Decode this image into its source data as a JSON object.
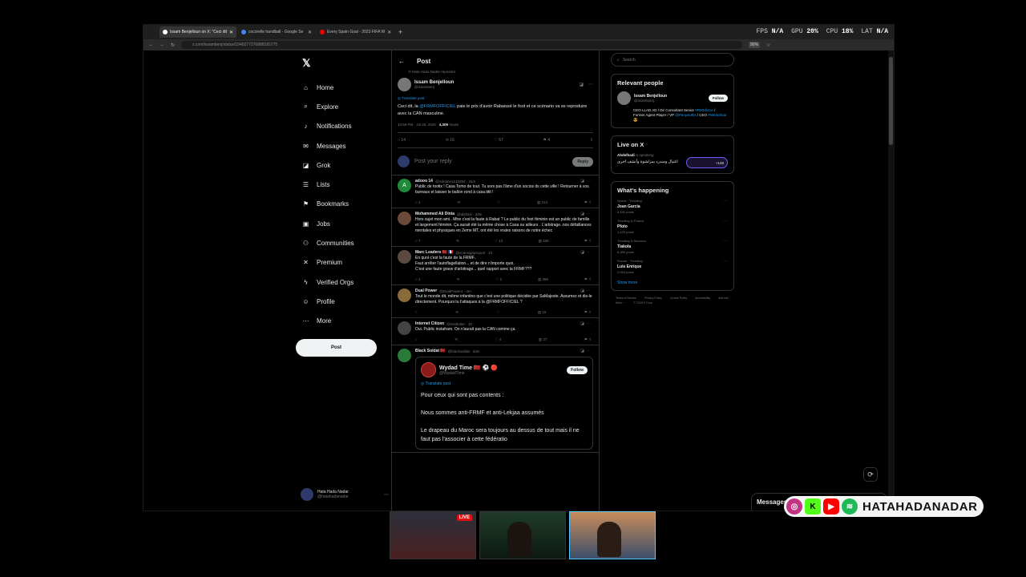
{
  "browser": {
    "tabs": [
      {
        "label": "Issam Benjelloun on X: \"Ceci dit",
        "active": true,
        "color": "#ffffff"
      },
      {
        "label": "cocorelle handball - Google Se",
        "active": false,
        "color": "#4285f4"
      },
      {
        "label": "Every Spain Goal - 2023 FIFA W",
        "active": false,
        "color": "#ff0000"
      }
    ],
    "url": "x.com/issambenj/status/1949277276888182775",
    "zoom": "90%"
  },
  "stats": {
    "fps_label": "FPS",
    "fps_value": "N/A",
    "gpu_label": "GPU",
    "gpu_value": "20%",
    "cpu_label": "CPU",
    "cpu_value": "18%",
    "lat_label": "LAT",
    "lat_value": "N/A"
  },
  "nav": {
    "items": [
      {
        "label": "Home",
        "icon": "home-icon",
        "glyph": "⌂"
      },
      {
        "label": "Explore",
        "icon": "search-icon",
        "glyph": "⌕"
      },
      {
        "label": "Notifications",
        "icon": "bell-icon",
        "glyph": "♪"
      },
      {
        "label": "Messages",
        "icon": "mail-icon",
        "glyph": "✉"
      },
      {
        "label": "Grok",
        "icon": "grok-icon",
        "glyph": "◪"
      },
      {
        "label": "Lists",
        "icon": "list-icon",
        "glyph": "☰"
      },
      {
        "label": "Bookmarks",
        "icon": "bookmark-icon",
        "glyph": "⚑"
      },
      {
        "label": "Jobs",
        "icon": "briefcase-icon",
        "glyph": "▣"
      },
      {
        "label": "Communities",
        "icon": "people-icon",
        "glyph": "⚇"
      },
      {
        "label": "Premium",
        "icon": "x-premium-icon",
        "glyph": "✕"
      },
      {
        "label": "Verified Orgs",
        "icon": "lightning-icon",
        "glyph": "ϟ"
      },
      {
        "label": "Profile",
        "icon": "person-icon",
        "glyph": "☺"
      },
      {
        "label": "More",
        "icon": "more-circle-icon",
        "glyph": "⋯"
      }
    ],
    "post_label": "Post"
  },
  "account": {
    "name": "Hata Hada Nadar",
    "handle": "@hatahadanadar"
  },
  "main": {
    "title": "Post",
    "repost_note": "Hata Hada Nadar reposted",
    "op": {
      "name": "Issam Benjelloun",
      "handle": "@issambenj",
      "translate": "Translate post",
      "text_a": "Ceci dit, la ",
      "mention": "@FRMFOFFICIEL",
      "text_b": " paie le prix d'avoir Rabaissé le foot et ce scénario va se reproduire avec la CAN masculine.",
      "time": "10:59 PM · Jul 26, 2025 · ",
      "views_count": "4,309",
      "views_label": " Views",
      "replies": "14",
      "reposts": "16",
      "likes": "67",
      "bookmarks": "4"
    },
    "reply_placeholder": "Post your reply",
    "reply_button": "Reply",
    "replies": [
      {
        "name": "adooo 14",
        "handle": "@Adnane1213283 · 34m",
        "text": "Public de tootix ! Casa Tomo de tout. Tu sors pas l'âme d'un socios ds cette ville ! Retourner à vos bureaux et laisser le ballon rond à casa.titit !",
        "replies": "1",
        "reposts": "",
        "likes": "",
        "views": "213",
        "avatar": "#1f8a3a",
        "initial": "A"
      },
      {
        "name": "Mohammed Ali Dinia",
        "handle": "@alidinia · 43m",
        "text": "Hors sujet mon ami.. Mtre c'est la faute à Rabat ? Le public du foot féminin est un public de famille et largement féminin. Ça aurait été la même chose à Casa ou ailleurs . L'arbitrage..nos défaillances mentales et physiques en 2eme MT, ont été les vraies raisons de notre échec",
        "replies": "7",
        "reposts": "",
        "likes": "13",
        "views": "335",
        "avatar": "#6b4a3a",
        "initial": ""
      },
      {
        "name": "Marc Leaders 🇲🇦 🇫🇷",
        "handle": "@ecdesignpropod · 1h",
        "text": "En quoi c'est la faute de la FRMF..\nFaut arrêter l'autoflagellation... et de dire n'importe quoi.\nC'est une faute grave d'arbitrage... quel rapport avec la FRMF???",
        "replies": "1",
        "reposts": "",
        "likes": "2",
        "views": "366",
        "avatar": "#5a4a3f",
        "initial": ""
      },
      {
        "name": "Dual Power",
        "handle": "@DualPower4 · 4m",
        "text": "Tout le monde dit, même infantino que c'est une politique décidée par SaMajeste. Assumez et dis-le directement. Pourquoi tu t'attaques à la @FRMFOFFICIEL ?",
        "replies": "",
        "reposts": "",
        "likes": "",
        "views": "15",
        "avatar": "#8a6a3a",
        "initial": ""
      },
      {
        "name": "Internet Citizen",
        "handle": "@nssbmler · 1h",
        "text": "Oui. Public instafram. On n'aurait pas la CAN comme ça.",
        "replies": "",
        "reposts": "",
        "likes": "4",
        "views": "27",
        "avatar": "#444444",
        "initial": ""
      }
    ],
    "quote_reply": {
      "name": "Black Soldat 🇲🇦",
      "handle": "@blacksoldat · 33m",
      "quote_name": "Wydad Time 🇲🇦 ⚽ 🔴",
      "quote_handle": "@WydadTime",
      "follow": "Follow",
      "translate": "Translate post",
      "text": "Pour ceux qui sont pas contents :\n\nNous sommes anti-FRMF et anti-Lekjaa assumés\n\nLe drapeau du Maroc sera toujours au dessus de tout mais il ne faut pas l'associer à cette fédératio",
      "avatar": "#2a7a3a"
    }
  },
  "right": {
    "search_placeholder": "Search",
    "relevant_title": "Relevant people",
    "person": {
      "name": "Issam Benjelloun",
      "handle": "@issambenj",
      "follow": "Follow",
      "bio_a": "CEO LLAD AD / Dir Consultant Senior ",
      "bio_link1": "#RMSforce",
      "bio_b": " / Former Agent Player / VP ",
      "bio_link2": "@PenyaUBA",
      "bio_c": " / CEO ",
      "bio_link3": "#Wertelmar",
      "bio_d": " 😎"
    },
    "live_title": "Live on X",
    "live": {
      "host": "Abdelhadi",
      "status": "is speaking",
      "title": "اغتيال وسدرد بمزلشوة وأنشف اخرى",
      "extra": "+145"
    },
    "happening_title": "What's happening",
    "trends": [
      {
        "cat": "Sports · Trending",
        "name": "Joan Garcia",
        "count": "5,440 posts"
      },
      {
        "cat": "Trending in France",
        "name": "Pfoto",
        "count": "1,433 posts"
      },
      {
        "cat": "Trending in Morocco",
        "name": "Tiakola",
        "count": "8,389 posts"
      },
      {
        "cat": "Soccer · Trending",
        "name": "Luis Enrique",
        "count": "2,054 posts"
      }
    ],
    "show_more": "Show more",
    "footer": [
      "Terms of Service",
      "Privacy Policy",
      "Cookie Policy",
      "Accessibility",
      "Ads info",
      "More ···",
      "© 2025 X Corp."
    ]
  },
  "messages_drawer": "Messages",
  "overlay": {
    "live_badge": "LIVE",
    "social_handle": "HATAHADANADAR"
  }
}
